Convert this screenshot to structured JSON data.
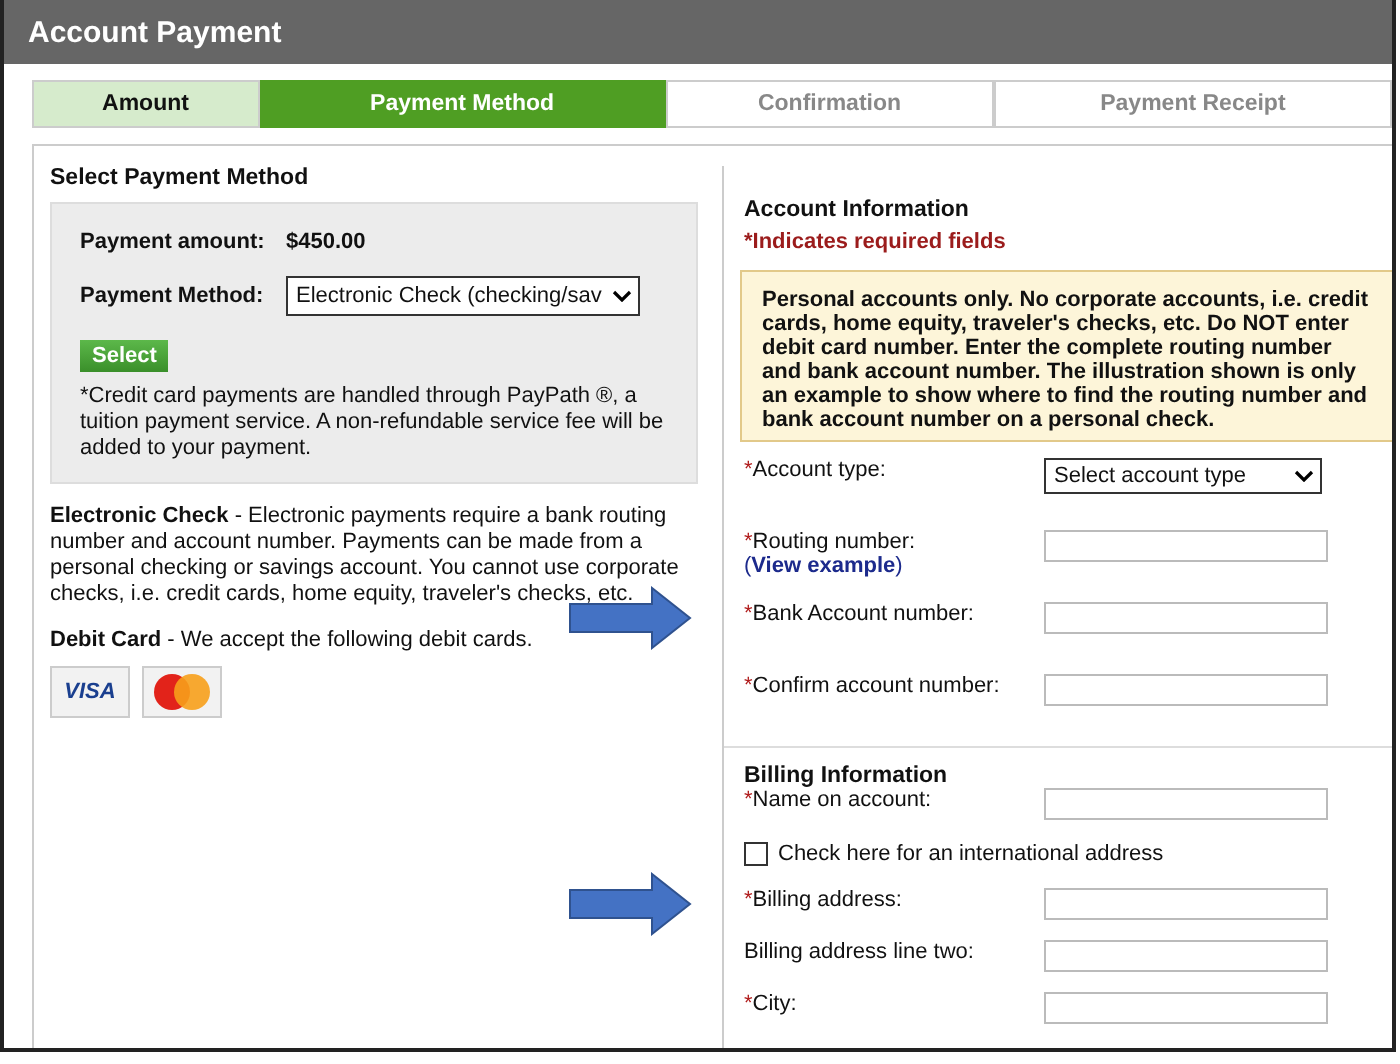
{
  "window": {
    "title": "Account Payment"
  },
  "steps": [
    {
      "label": "Amount",
      "selected": false,
      "completed": true
    },
    {
      "label": "Payment Method",
      "selected": true,
      "completed": false
    },
    {
      "label": "Confirmation",
      "selected": false,
      "completed": false
    },
    {
      "label": "Payment Receipt",
      "selected": false,
      "completed": false
    }
  ],
  "payment": {
    "heading": "Select Payment Method",
    "amount_label": "Payment amount:",
    "amount": "$450.00",
    "method_label": "Payment Method:",
    "method_value": "Electronic Check (checking/sav",
    "select_button": "Select",
    "note": "*Credit card payments are handled through PayPath ®, a tuition payment service. A non-refundable service fee will be added to your payment.",
    "echeck_text": "**Electronic Check** - Electronic payments require a bank routing number and account number. Payments can be made from a personal checking or savings account. You cannot use corporate checks, i.e. credit cards, home equity, traveler's checks, etc.",
    "debit_text": "**Debit Card** - We accept the following debit cards.",
    "cards": [
      {
        "kind": "visa",
        "label": "VISA"
      },
      {
        "kind": "mastercard"
      }
    ]
  },
  "account": {
    "heading": "Account Information",
    "required_note": "*Indicates required fields",
    "notice": "Personal accounts only. No corporate accounts, i.e. credit cards, home equity, traveler's checks, etc. Do NOT enter debit card number. Enter the complete routing number and bank account number. The illustration shown is only an example to show where to find the routing number and bank account number on a personal check.",
    "fields": [
      {
        "kind": "select",
        "marker": "*",
        "label": "Account type:",
        "value": "Select account type"
      },
      {
        "kind": "input",
        "marker": "*",
        "label": "Routing number:",
        "link": {
          "before": "(",
          "text": "View example",
          "after": ")"
        }
      },
      {
        "kind": "input",
        "marker": "*",
        "label": "Bank Account number:",
        "arrow": true
      },
      {
        "kind": "input",
        "marker": "*",
        "label": "Confirm account number:"
      }
    ]
  },
  "billing": {
    "heading": "Billing Information",
    "fields": [
      {
        "kind": "input",
        "marker": "*",
        "label": "Name on account:"
      },
      {
        "kind": "checkbox",
        "label": "Check here for an international address",
        "checked": false
      },
      {
        "kind": "input",
        "marker": "*",
        "label": "Billing address:",
        "arrow": true
      },
      {
        "kind": "input",
        "label": "Billing address line two:"
      },
      {
        "kind": "input",
        "marker": "*",
        "label": "City:"
      }
    ]
  }
}
